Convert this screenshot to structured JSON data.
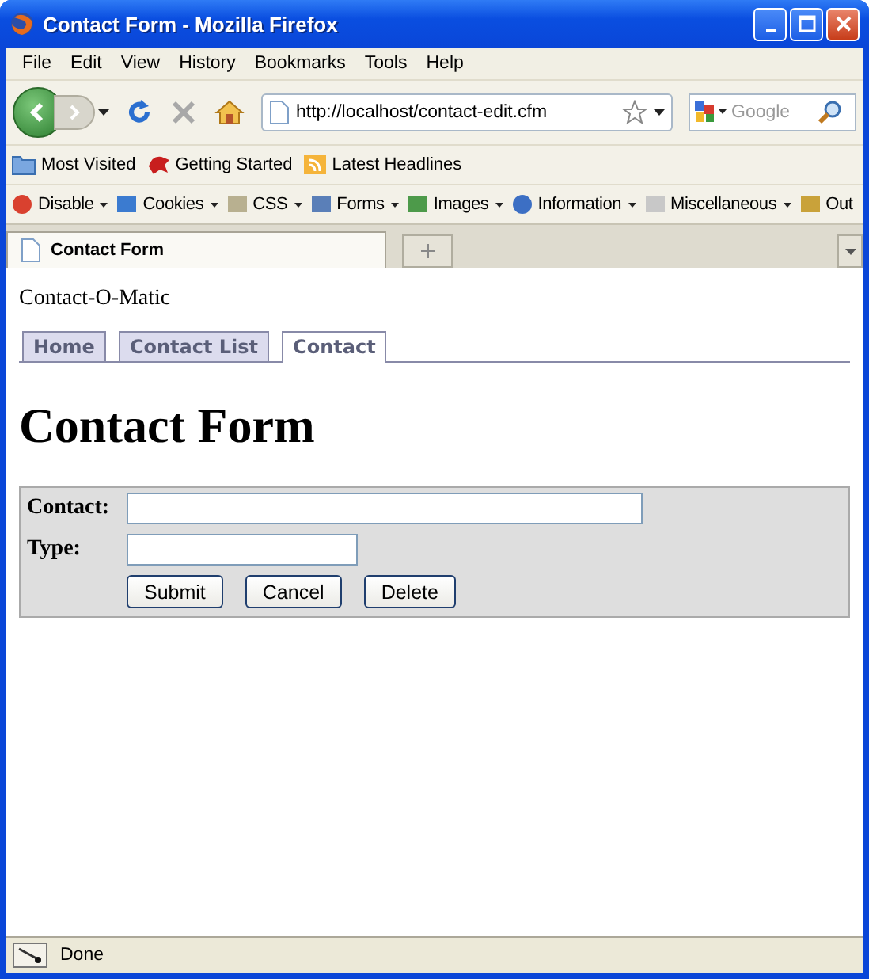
{
  "window": {
    "title": "Contact Form - Mozilla Firefox"
  },
  "menu": [
    "File",
    "Edit",
    "View",
    "History",
    "Bookmarks",
    "Tools",
    "Help"
  ],
  "address": {
    "url": "http://localhost/contact-edit.cfm"
  },
  "search": {
    "placeholder": "Google"
  },
  "bookmarks": [
    "Most Visited",
    "Getting Started",
    "Latest Headlines"
  ],
  "devtools": [
    {
      "label": "Disable",
      "dropdown": true
    },
    {
      "label": "Cookies",
      "dropdown": true
    },
    {
      "label": "CSS",
      "dropdown": true
    },
    {
      "label": "Forms",
      "dropdown": true
    },
    {
      "label": "Images",
      "dropdown": true
    },
    {
      "label": "Information",
      "dropdown": true
    },
    {
      "label": "Miscellaneous",
      "dropdown": true
    },
    {
      "label": "Out",
      "dropdown": false
    }
  ],
  "tabs": [
    {
      "label": "Contact Form",
      "selected": true
    }
  ],
  "page": {
    "site_name": "Contact-O-Matic",
    "nav_tabs": [
      {
        "label": "Home",
        "selected": false
      },
      {
        "label": "Contact List",
        "selected": false
      },
      {
        "label": "Contact",
        "selected": true
      }
    ],
    "heading": "Contact Form",
    "fields": [
      {
        "label": "Contact:"
      },
      {
        "label": "Type:"
      }
    ],
    "buttons": [
      "Submit",
      "Cancel",
      "Delete"
    ]
  },
  "status_bar": {
    "text": "Done"
  }
}
